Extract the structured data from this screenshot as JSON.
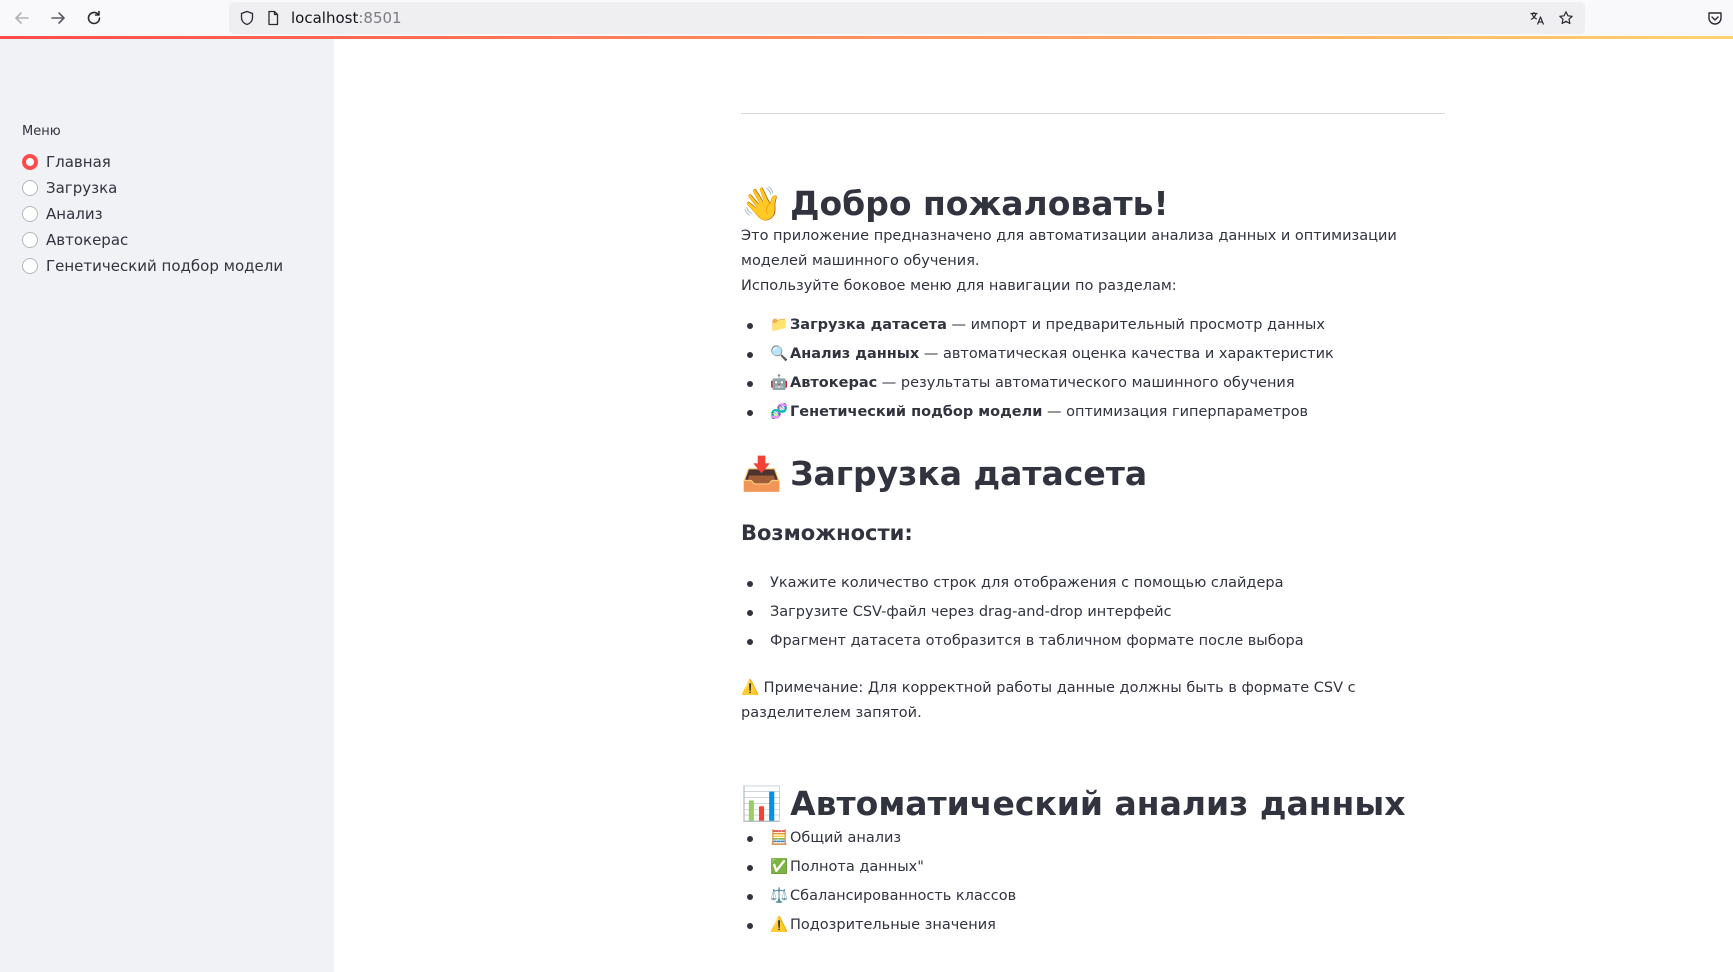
{
  "browser": {
    "url_host": "localhost",
    "url_port": ":8501",
    "icons": [
      "back-icon",
      "forward-icon",
      "reload-icon",
      "shield-icon",
      "page-icon",
      "translate-icon",
      "star-icon",
      "pocket-icon"
    ]
  },
  "sidebar": {
    "menu_label": "Меню",
    "items": [
      {
        "label": "Главная",
        "selected": true
      },
      {
        "label": "Загрузка",
        "selected": false
      },
      {
        "label": "Анализ",
        "selected": false
      },
      {
        "label": "Автокерас",
        "selected": false
      },
      {
        "label": "Генетический подбор модели",
        "selected": false
      }
    ],
    "accent_color": "#ff4b4b"
  },
  "welcome": {
    "emoji": "👋",
    "title": "Добро пожаловать!",
    "intro_line1": "Это приложение предназначено для автоматизации анализа данных и оптимизации моделей машинного обучения.",
    "intro_line2": "Используйте боковое меню для навигации по разделам:",
    "sections": [
      {
        "emoji": "📁",
        "name": "Загрузка датасета",
        "desc": " — импорт и предварительный просмотр данных"
      },
      {
        "emoji": "🔍",
        "name": "Анализ данных",
        "desc": " — автоматическая оценка качества и характеристик"
      },
      {
        "emoji": "🤖",
        "name": "Автокерас",
        "desc": " — результаты автоматического машинного обучения"
      },
      {
        "emoji": "🧬",
        "name": "Генетический подбор модели",
        "desc": " — оптимизация гиперпараметров"
      }
    ]
  },
  "upload": {
    "emoji": "📥",
    "title": "Загрузка датасета",
    "features_title": "Возможности:",
    "features": [
      "Укажите количество строк для отображения с помощью слайдера",
      "Загрузите CSV-файл через drag-and-drop интерфейс",
      "Фрагмент датасета отобразится в табличном формате после выбора"
    ],
    "note": "⚠️ Примечание: Для корректной работы данные должны быть в формате CSV с разделителем запятой."
  },
  "analysis": {
    "emoji": "📊",
    "title": "Автоматический анализ данных",
    "items": [
      {
        "emoji": "🧮",
        "text": "Общий анализ"
      },
      {
        "emoji": "✅",
        "text": "Полнота данных\""
      },
      {
        "emoji": "⚖️",
        "text": "Сбалансированность классов"
      },
      {
        "emoji": "⚠️",
        "text": "Подозрительные значения"
      }
    ]
  }
}
